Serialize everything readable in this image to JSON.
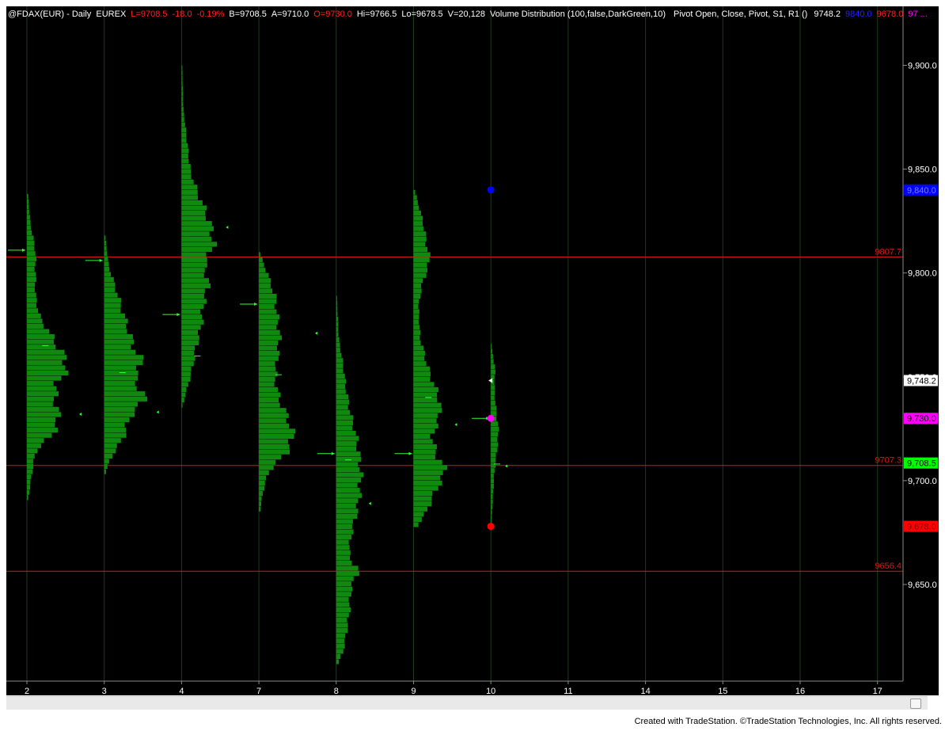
{
  "header": {
    "symbol": "@FDAX(EUR) - Daily  EUREX",
    "last": "L=9708.5",
    "change": "-18.0",
    "change_pct": "-0.19%",
    "bid": "B=9708.5",
    "ask": "A=9710.0",
    "open": "O=9730.0",
    "high": "Hi=9766.5",
    "low": "Lo=9678.5",
    "volume": "V=20,128",
    "indicator1": "Volume Distribution (100,false,DarkGreen,10)",
    "indicator2": "Pivot Open, Close, Pivot, S1, R1 ()",
    "ind_pivot": "9748.2",
    "ind_r1": "9840.0",
    "ind_s1": "9678.0",
    "ind_trunc": "97 ..."
  },
  "colors": {
    "background": "#000000",
    "profile": "#0f8a0f",
    "arrow": "#33ff33",
    "line": "#d11a1a",
    "grid": "#1f3a1f",
    "r1_dot": "#0000ff",
    "s1_dot": "#ff0000",
    "pivot_dot": "#ff00ff",
    "marker": "#ffffff"
  },
  "footer": {
    "credit": "Created with TradeStation. ©TradeStation Technologies, Inc. All rights reserved."
  },
  "chart_data": {
    "type": "volume-profile",
    "ylim": [
      9605,
      9920
    ],
    "y_ticks": [
      {
        "value": 9900,
        "label": "9,900.0"
      },
      {
        "value": 9850,
        "label": "9,850.0"
      },
      {
        "value": 9800,
        "label": "9,800.0"
      },
      {
        "value": 9750,
        "label": "9,750.0"
      },
      {
        "value": 9700,
        "label": "9,700.0"
      },
      {
        "value": 9650,
        "label": "9,650.0"
      }
    ],
    "x_labels": [
      "2",
      "3",
      "4",
      "7",
      "8",
      "9",
      "10",
      "11",
      "14",
      "15",
      "16",
      "17"
    ],
    "horizontal_lines": [
      {
        "value": 9807.7,
        "label": "9807.7"
      },
      {
        "value": 9707.3,
        "label": "9707.3"
      },
      {
        "value": 9656.4,
        "label": "9656.4"
      }
    ],
    "price_tags": [
      {
        "value": 9840.0,
        "label": "9,840.0",
        "bg": "#0000ff",
        "fg": "#7f7fff"
      },
      {
        "value": 9748.2,
        "label": "9,748.2",
        "bg": "#ffffff",
        "fg": "#000000"
      },
      {
        "value": 9730.0,
        "label": "9,730.0",
        "bg": "#ff00ff",
        "fg": "#000000"
      },
      {
        "value": 9708.5,
        "label": "9,708.5",
        "bg": "#00ff00",
        "fg": "#000000"
      },
      {
        "value": 9678.0,
        "label": "9,678.0",
        "bg": "#ff0000",
        "fg": "#7f0000"
      }
    ],
    "sessions": [
      {
        "x": "2",
        "high": 9838,
        "low": 9691,
        "open": 9811,
        "close": 9732,
        "mid": 9765,
        "width": 60,
        "shape": [
          [
            9838,
            0.03
          ],
          [
            9825,
            0.08
          ],
          [
            9812,
            0.2
          ],
          [
            9800,
            0.2
          ],
          [
            9790,
            0.2
          ],
          [
            9780,
            0.3
          ],
          [
            9770,
            0.6
          ],
          [
            9762,
            0.85
          ],
          [
            9755,
            0.95
          ],
          [
            9748,
            0.7
          ],
          [
            9740,
            0.65
          ],
          [
            9732,
            0.75
          ],
          [
            9725,
            0.65
          ],
          [
            9715,
            0.2
          ],
          [
            9705,
            0.12
          ],
          [
            9691,
            0.02
          ]
        ]
      },
      {
        "x": "3",
        "high": 9818,
        "low": 9705,
        "open": 9806,
        "close": 9733,
        "mid": 9752,
        "width": 60,
        "shape": [
          [
            9818,
            0.03
          ],
          [
            9805,
            0.1
          ],
          [
            9795,
            0.25
          ],
          [
            9785,
            0.4
          ],
          [
            9775,
            0.55
          ],
          [
            9765,
            0.7
          ],
          [
            9758,
            0.9
          ],
          [
            9750,
            0.7
          ],
          [
            9745,
            0.85
          ],
          [
            9740,
            0.95
          ],
          [
            9732,
            0.6
          ],
          [
            9722,
            0.45
          ],
          [
            9712,
            0.15
          ],
          [
            9705,
            0.03
          ]
        ]
      },
      {
        "x": "4",
        "high": 9900,
        "low": 9737,
        "open": 9780,
        "close": 9822,
        "mid": 9760,
        "width": 50,
        "shape": [
          [
            9900,
            0.02
          ],
          [
            9880,
            0.05
          ],
          [
            9865,
            0.15
          ],
          [
            9850,
            0.25
          ],
          [
            9840,
            0.45
          ],
          [
            9830,
            0.7
          ],
          [
            9822,
            0.85
          ],
          [
            9815,
            0.9
          ],
          [
            9805,
            0.65
          ],
          [
            9795,
            0.75
          ],
          [
            9785,
            0.6
          ],
          [
            9775,
            0.55
          ],
          [
            9765,
            0.4
          ],
          [
            9755,
            0.3
          ],
          [
            9745,
            0.15
          ],
          [
            9737,
            0.02
          ]
        ]
      },
      {
        "x": "7",
        "high": 9810,
        "low": 9685,
        "open": 9785,
        "close": 9771,
        "mid": 9751,
        "width": 65,
        "shape": [
          [
            9810,
            0.03
          ],
          [
            9800,
            0.2
          ],
          [
            9790,
            0.35
          ],
          [
            9780,
            0.4
          ],
          [
            9770,
            0.45
          ],
          [
            9760,
            0.4
          ],
          [
            9750,
            0.35
          ],
          [
            9740,
            0.45
          ],
          [
            9730,
            0.65
          ],
          [
            9722,
            0.75
          ],
          [
            9715,
            0.6
          ],
          [
            9705,
            0.2
          ],
          [
            9695,
            0.08
          ],
          [
            9685,
            0.02
          ]
        ]
      },
      {
        "x": "8",
        "high": 9789,
        "low": 9612,
        "open": 9713,
        "close": 9689,
        "mid": 9710,
        "width": 35,
        "shape": [
          [
            9789,
            0.03
          ],
          [
            9770,
            0.1
          ],
          [
            9755,
            0.3
          ],
          [
            9745,
            0.4
          ],
          [
            9735,
            0.55
          ],
          [
            9720,
            0.85
          ],
          [
            9705,
            1.0
          ],
          [
            9690,
            0.9
          ],
          [
            9675,
            0.6
          ],
          [
            9665,
            0.5
          ],
          [
            9658,
            0.9
          ],
          [
            9650,
            0.6
          ],
          [
            9635,
            0.5
          ],
          [
            9620,
            0.3
          ],
          [
            9612,
            0.05
          ]
        ]
      },
      {
        "x": "9",
        "high": 9840,
        "low": 9678,
        "open": 9713,
        "close": 9727,
        "mid": 9740,
        "width": 46,
        "shape": [
          [
            9840,
            0.05
          ],
          [
            9825,
            0.3
          ],
          [
            9815,
            0.4
          ],
          [
            9807,
            0.5
          ],
          [
            9795,
            0.25
          ],
          [
            9785,
            0.15
          ],
          [
            9770,
            0.2
          ],
          [
            9755,
            0.45
          ],
          [
            9740,
            0.8
          ],
          [
            9732,
            0.8
          ],
          [
            9722,
            0.55
          ],
          [
            9712,
            0.75
          ],
          [
            9706,
            1.0
          ],
          [
            9697,
            0.7
          ],
          [
            9685,
            0.35
          ],
          [
            9678,
            0.05
          ]
        ]
      },
      {
        "x": "10",
        "high": 9766,
        "low": 9678,
        "open": 9730,
        "close": 9707,
        "mid": 9708,
        "width": 12,
        "shape": [
          [
            9766,
            0.05
          ],
          [
            9755,
            0.5
          ],
          [
            9745,
            0.4
          ],
          [
            9735,
            0.6
          ],
          [
            9725,
            0.9
          ],
          [
            9715,
            0.7
          ],
          [
            9705,
            0.4
          ],
          [
            9690,
            0.2
          ],
          [
            9678,
            0.05
          ]
        ]
      }
    ],
    "pivot_points": [
      {
        "x": "10",
        "value": 9840.0,
        "kind": "R1"
      },
      {
        "x": "10",
        "value": 9730.0,
        "kind": "Open"
      },
      {
        "x": "10",
        "value": 9678.0,
        "kind": "S1"
      }
    ],
    "current_marker": {
      "x": "10",
      "value": 9748.2
    }
  }
}
